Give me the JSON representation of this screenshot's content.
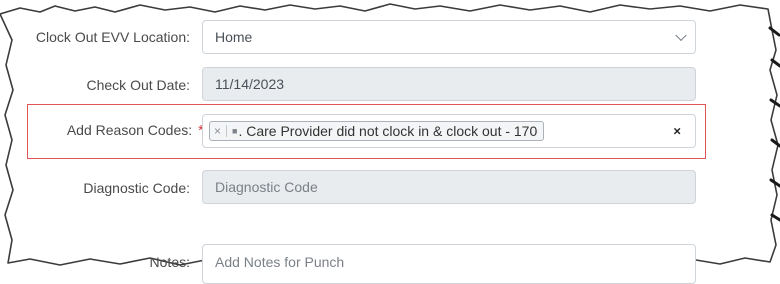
{
  "form": {
    "clock_out_location": {
      "label": "Clock Out EVV Location:",
      "value": "Home"
    },
    "check_out_date": {
      "label": "Check Out Date:",
      "value": "11/14/2023"
    },
    "reason_codes": {
      "label": "Add Reason Codes:",
      "required_mark": "*",
      "selected_tag": ". Care Provider did not clock in & clock out - 170",
      "clear_symbol": "×",
      "tag_remove_symbol": "×"
    },
    "diagnostic_code": {
      "label": "Diagnostic Code:",
      "placeholder": "Diagnostic Code"
    },
    "notes": {
      "label": "Notes:",
      "placeholder": "Add Notes for Punch"
    }
  },
  "colors": {
    "highlight_border": "#e25557",
    "required_star": "#d9363e",
    "readonly_bg": "#e9ecef"
  },
  "icons": [
    "chevron-down-icon",
    "close-icon"
  ]
}
